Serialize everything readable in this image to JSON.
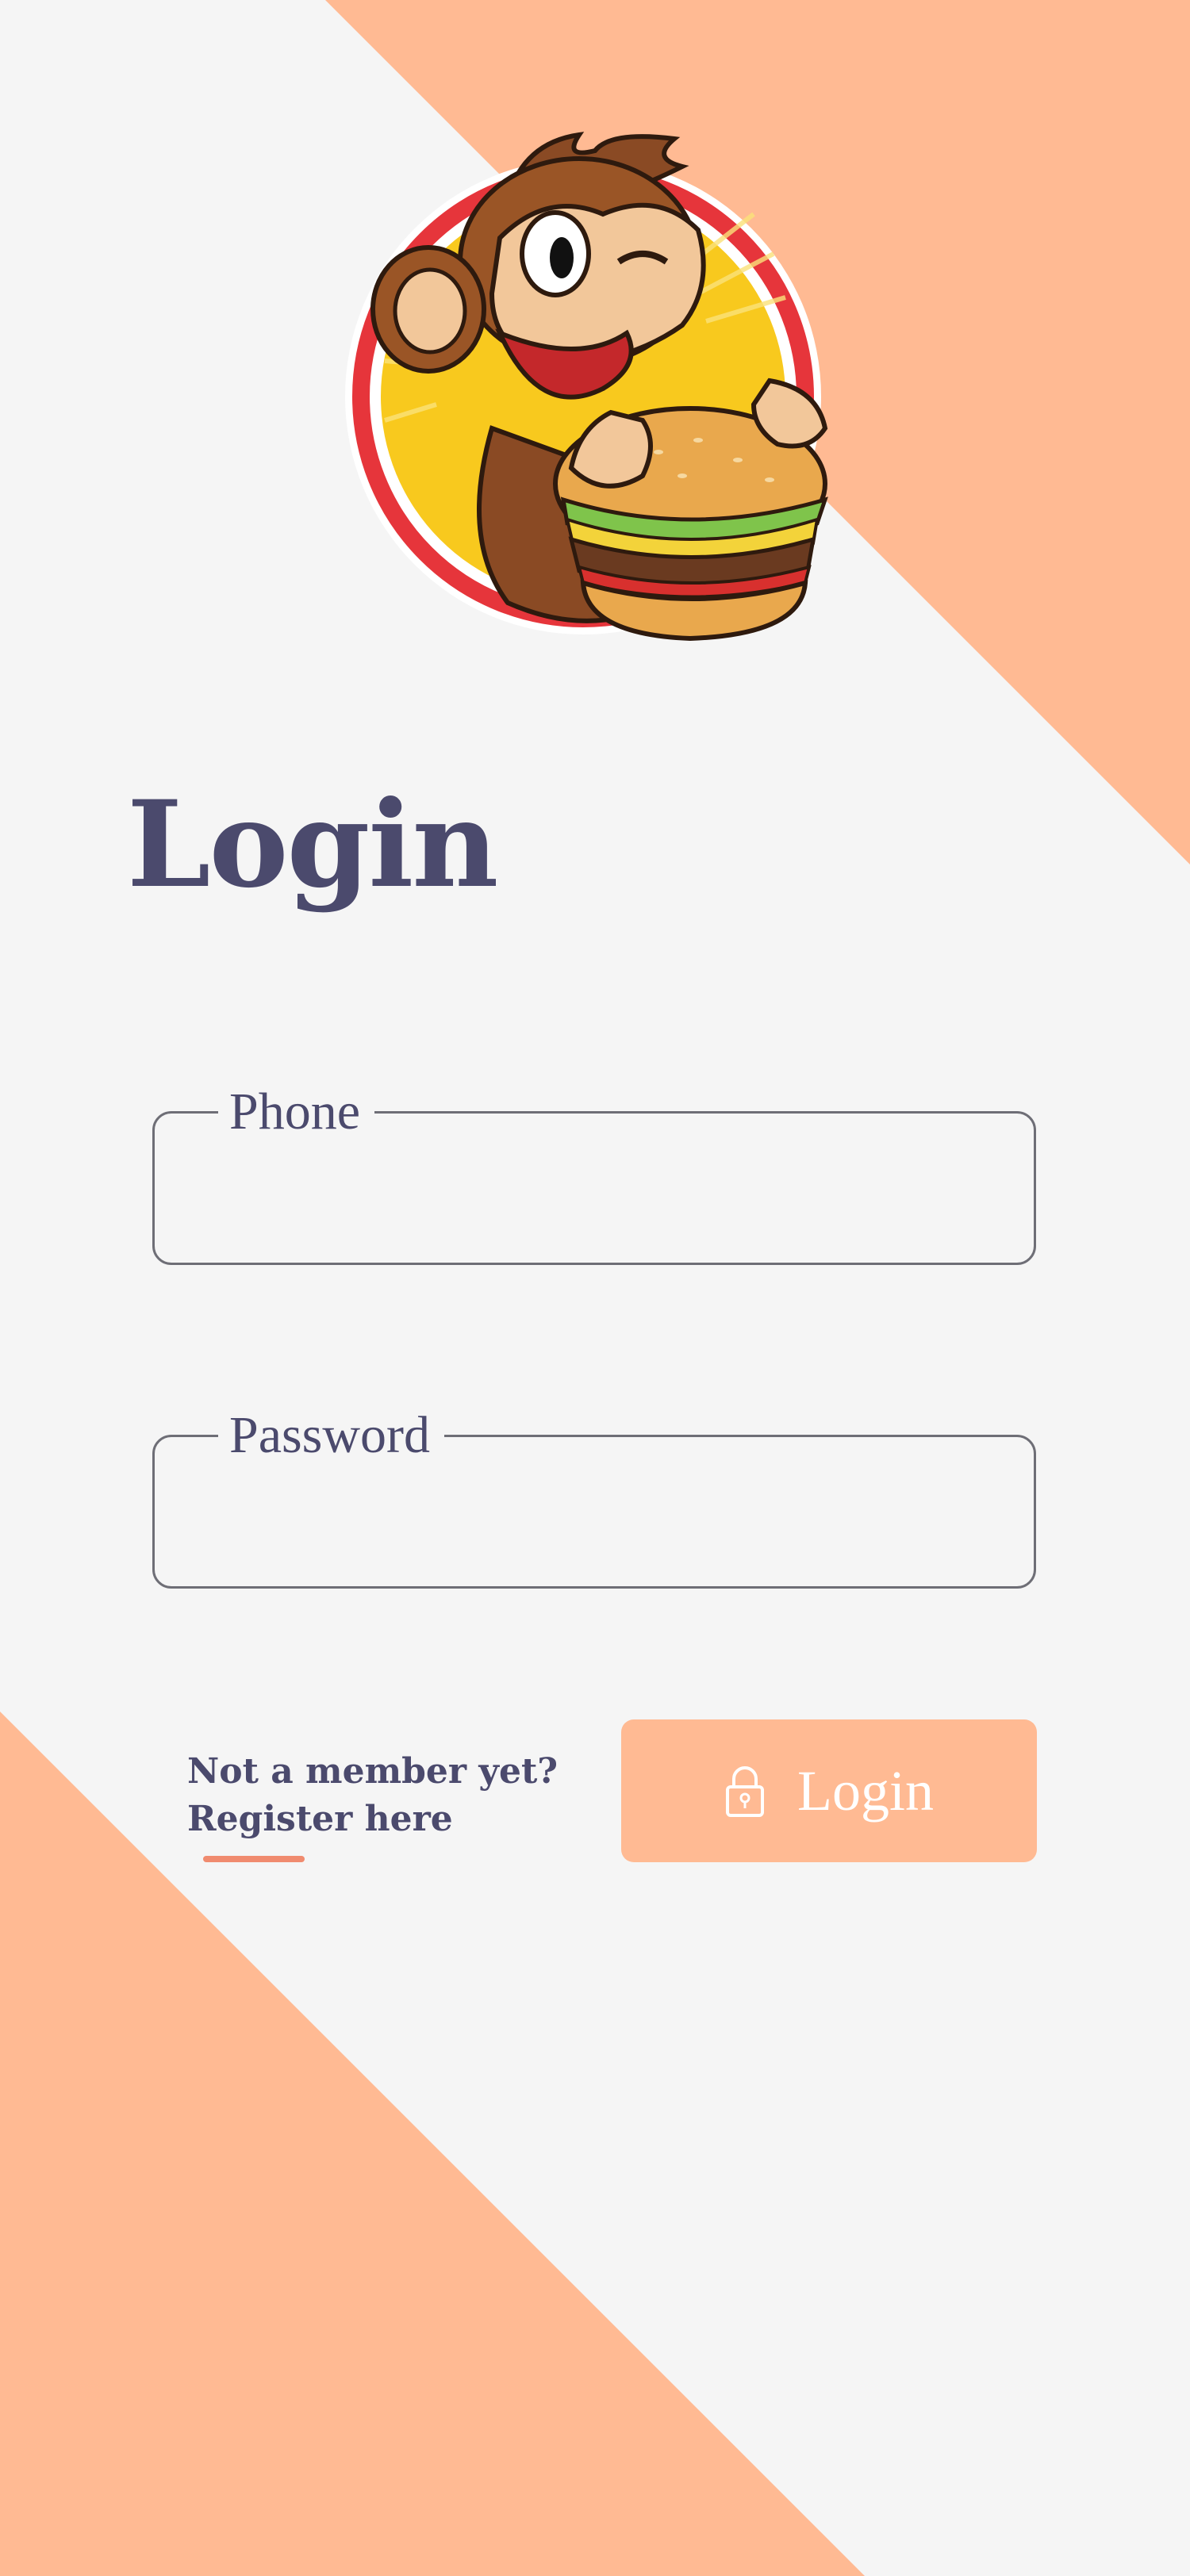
{
  "colors": {
    "background": "#f5f5f5",
    "accent": "#ffba93",
    "primary_text": "#4b4a6d",
    "field_border": "#6e6e76",
    "underline": "#f08b6f",
    "button_text": "#ffffff"
  },
  "logo": {
    "icon": "monkey-eating-burger-logo"
  },
  "page": {
    "title": "Login"
  },
  "form": {
    "phone": {
      "label": "Phone",
      "value": ""
    },
    "password": {
      "label": "Password",
      "value": ""
    }
  },
  "register": {
    "line1": "Not a member yet?",
    "line2": "Register here"
  },
  "login_button": {
    "label": "Login",
    "icon": "lock-icon"
  }
}
